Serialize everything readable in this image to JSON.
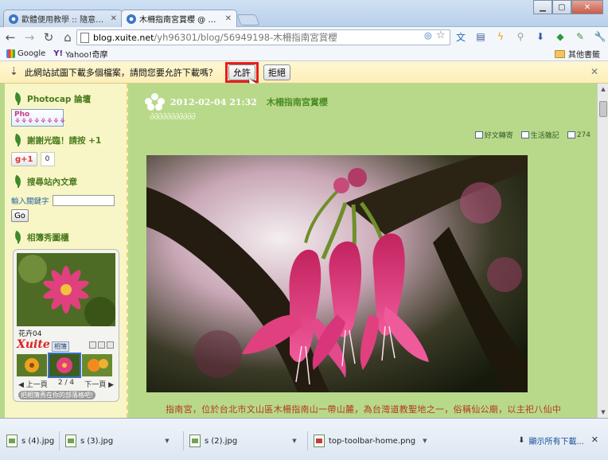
{
  "tabs": [
    {
      "label": "歡體便用教學 :: 隨意窩 Xu"
    },
    {
      "label": "木柵指南宮賞櫻 @ 歡體便"
    }
  ],
  "address": {
    "host": "blog.xuite.net",
    "path": "/yh96301/blog/56949198-木柵指南宮賞櫻"
  },
  "bookmarks": {
    "items": [
      {
        "label": "Google"
      },
      {
        "label": "Yahoo!奇摩"
      }
    ],
    "other_label": "其他書籤"
  },
  "infobar": {
    "message": "此網站試圖下載多個檔案，請問您要允許下載嗎？",
    "allow_label": "允許",
    "deny_label": "拒絕"
  },
  "sidebar": {
    "photocap_title": "Photocap 論壇",
    "thanks_title": "謝謝光臨！請按 +1",
    "gplus_label": "+1",
    "gplus_count": "0",
    "search_title": "搜尋站內文章",
    "keyword_label": "輸入關鍵字",
    "go_label": "Go",
    "album_title": "相簿秀圖櫃",
    "album_caption": "花卉04",
    "xuite_logo": "Xuite",
    "xuite_badge": "相簿",
    "prev_label": "上一頁",
    "page_indicator": "2 / 4",
    "next_label": "下一頁",
    "album_footer": "把相簿秀在你的部落格吧!"
  },
  "post": {
    "date": "2012-02-04 21:32",
    "title": "木柵指南宮賞櫻",
    "meta": [
      {
        "label": "好文轉寄"
      },
      {
        "label": "生活雜記"
      },
      {
        "label": "274"
      }
    ],
    "body": "指南宮，位於台北市文山區木柵指南山一帶山麓，為台灣道教聖地之一，俗稱仙公廟，以主祀八仙中"
  },
  "downloads": [
    {
      "name": "s (4).jpg"
    },
    {
      "name": "s (3).jpg"
    },
    {
      "name": "s (2).jpg"
    },
    {
      "name": "top-toolbar-home.png"
    }
  ],
  "shelf": {
    "show_all_label": "顯示所有下載..."
  },
  "colors": {
    "page_bg": "#b8d98a",
    "sidebar_bg": "#f8f5c6",
    "infobar_bg": "#fcefb8",
    "highlight": "#e41e1e",
    "title_green": "#4b8c23"
  }
}
